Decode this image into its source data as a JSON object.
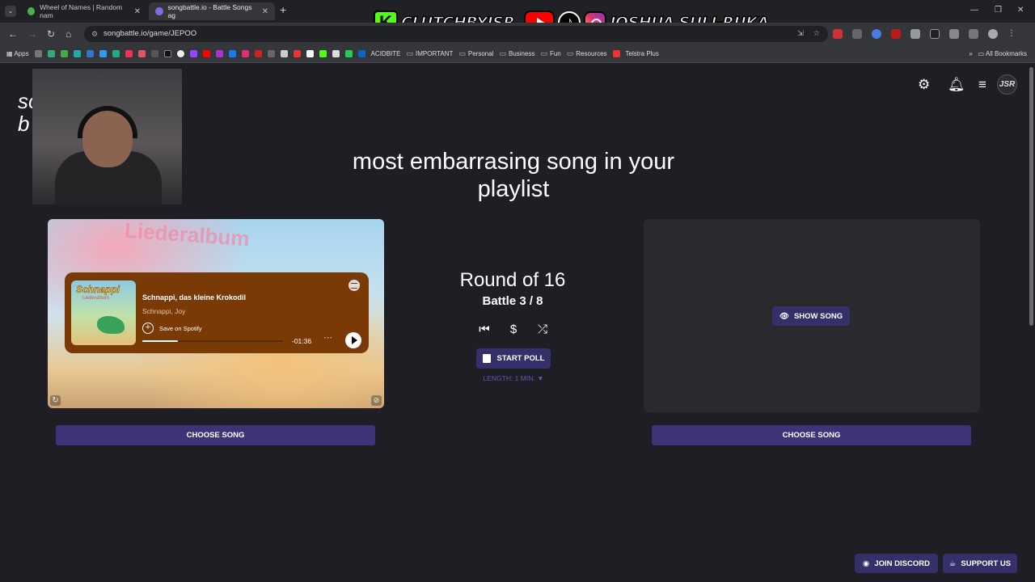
{
  "browser": {
    "tab_search_icon": "chevron-down-icon",
    "tabs": [
      {
        "title": "Wheel of Names | Random nam",
        "active": false
      },
      {
        "title": "songbattle.io - Battle Songs ag",
        "active": true
      }
    ],
    "new_tab_symbol": "+",
    "url": "songbattle.io/game/JEPOO",
    "bookmarks": {
      "apps": "Apps",
      "items": [
        "ACIDBITE",
        "IMPORTANT",
        "Personal",
        "Business",
        "Fun",
        "Resources",
        "Telstra Plus"
      ],
      "all_bookmarks": "All Bookmarks"
    }
  },
  "stream_overlay": {
    "kick_handle": "CLUTCHBYJSR",
    "social_name": "JOSHUA SULI-RUKA"
  },
  "site": {
    "logo_text_line1": "so",
    "logo_text_line2": "b",
    "avatar_initials": "JSR"
  },
  "battle": {
    "prompt": "most embarrasing song in your playlist",
    "round": "Round of 16",
    "battle_progress": "Battle 3 / 8",
    "start_poll": "START POLL",
    "length_label": "LENGTH: 1 MIN. ▼",
    "choose_song_left": "CHOOSE SONG",
    "choose_song_right": "CHOOSE SONG",
    "show_song": "SHOW SONG"
  },
  "left_song": {
    "album_cover_title": "Schnappi",
    "album_cover_subtitle": "Liederalbum",
    "blurred_bg_text": "Liederalbum",
    "title": "Schnappi, das kleine Krokodil",
    "artist": "Schnappi, Joy",
    "save_label": "Save on Spotify",
    "time_remaining": "-01:36",
    "progress_fraction": 0.25
  },
  "footer": {
    "join_discord": "JOIN DISCORD",
    "support_us": "SUPPORT US"
  },
  "colors": {
    "page_bg": "#1f1e24",
    "accent_button": "#36306a",
    "choose_button": "#3d3478",
    "spotify_embed_bg": "#7a3a06"
  }
}
